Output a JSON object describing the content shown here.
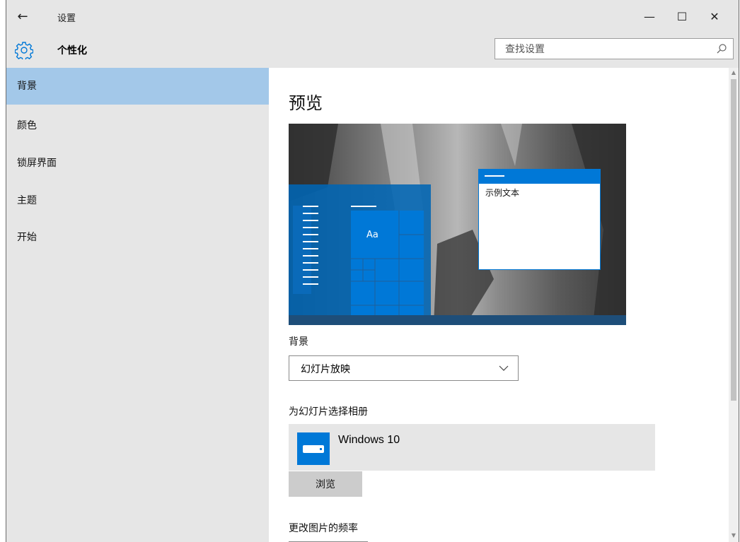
{
  "window": {
    "title": "设置",
    "back_glyph": "←",
    "minimize_glyph": "—",
    "maximize_glyph": "☐",
    "close_glyph": "✕"
  },
  "header": {
    "page_title": "个性化",
    "icon": "gear-icon",
    "search": {
      "placeholder": "查找设置",
      "value": ""
    }
  },
  "sidebar": {
    "items": [
      {
        "label": "背景",
        "active": true
      },
      {
        "label": "颜色",
        "active": false
      },
      {
        "label": "锁屏界面",
        "active": false
      },
      {
        "label": "主题",
        "active": false
      },
      {
        "label": "开始",
        "active": false
      }
    ]
  },
  "main": {
    "preview_heading": "预览",
    "preview": {
      "tile_text": "Aa",
      "sample_window_text": "示例文本"
    },
    "background_label": "背景",
    "background_select": {
      "selected": "幻灯片放映"
    },
    "album_label": "为幻灯片选择相册",
    "album": {
      "name": "Windows 10",
      "icon": "monitor-icon"
    },
    "browse_label": "浏览",
    "frequency_label": "更改图片的频率"
  },
  "colors": {
    "accent": "#0078d7",
    "sidebar_bg": "#e6e6e6",
    "selected_item": "#a3c8e9"
  }
}
